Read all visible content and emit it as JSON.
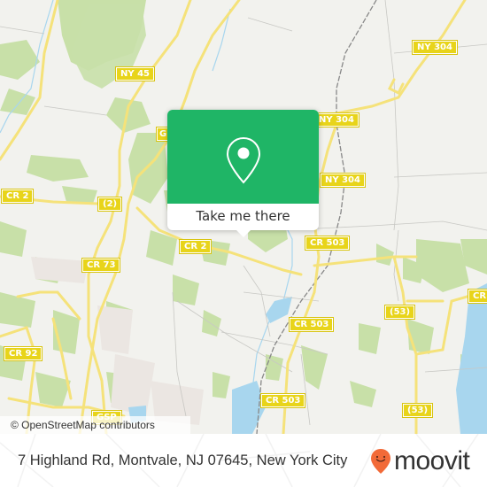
{
  "map": {
    "colors": {
      "background": "#f2f2ee",
      "wood": "#c8e0a8",
      "water": "#a8d6ee",
      "road_major": "#f5e27a",
      "road_minor": "#c8c8c4",
      "rail": "#888888",
      "shield": "#e8d41a",
      "popup_accent": "#1fb566",
      "brand_pin": "#f26a38"
    },
    "road_labels": [
      {
        "id": "ny45",
        "text": "NY 45"
      },
      {
        "id": "gsp-top",
        "text": "G"
      },
      {
        "id": "ny304-a",
        "text": "NY 304"
      },
      {
        "id": "ny304-b",
        "text": "NY 304"
      },
      {
        "id": "ny304-c",
        "text": "NY 304"
      },
      {
        "id": "cr2-left",
        "text": "CR 2"
      },
      {
        "id": "route2",
        "text": "(2)"
      },
      {
        "id": "cr2-mid",
        "text": "CR 2"
      },
      {
        "id": "cr73",
        "text": "CR 73"
      },
      {
        "id": "cr503-a",
        "text": "CR 503"
      },
      {
        "id": "cr503-b",
        "text": "CR 503"
      },
      {
        "id": "cr503-c",
        "text": "CR 503"
      },
      {
        "id": "route53-a",
        "text": "(53)"
      },
      {
        "id": "route53-b",
        "text": "(53)"
      },
      {
        "id": "cr-right",
        "text": "CR"
      },
      {
        "id": "cr92",
        "text": "CR 92"
      },
      {
        "id": "gsp-bottom",
        "text": "GSP"
      }
    ],
    "attribution": "© OpenStreetMap contributors"
  },
  "popup": {
    "icon": "location-pin-icon",
    "button_label": "Take me there"
  },
  "footer": {
    "address": "7 Highland Rd, Montvale, NJ 07645, New York City",
    "brand": {
      "name": "moovit",
      "icon": "moovit-pin-icon"
    }
  }
}
